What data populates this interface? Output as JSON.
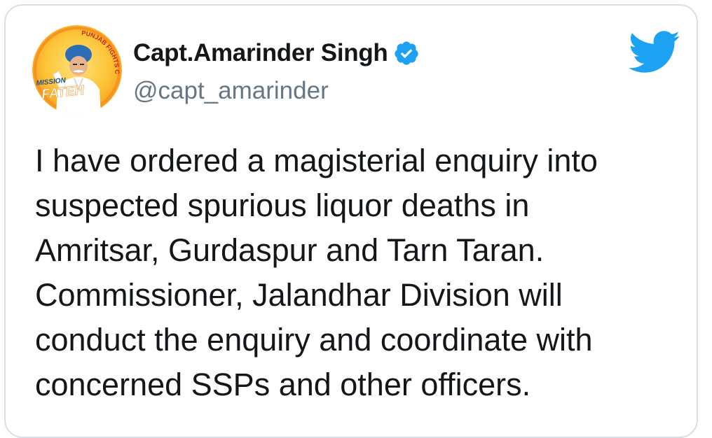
{
  "tweet": {
    "author": {
      "display_name": "Capt.Amarinder Singh",
      "handle": "@capt_amarinder",
      "verified": true,
      "avatar_icon": "mission-fateh-avatar",
      "avatar_text": {
        "badge_top": "MISSION",
        "badge_main": "FATEH",
        "arc_text": "PUNJAB FIGHTS CORONA"
      }
    },
    "platform_icon": "twitter-bird-icon",
    "text_lines": [
      "I have ordered a magisterial enquiry into",
      "suspected spurious liquor deaths in",
      "Amritsar, Gurdaspur and Tarn Taran.",
      "Commissioner, Jalandhar Division will",
      "conduct the enquiry and coordinate with",
      "concerned SSPs and other officers."
    ]
  },
  "colors": {
    "twitter_blue": "#1da1f2",
    "name_text": "#14171a",
    "handle_text": "#657786",
    "card_border": "#d9dee3",
    "avatar_orange": "#f7941d",
    "avatar_yellow": "#fcc437"
  }
}
